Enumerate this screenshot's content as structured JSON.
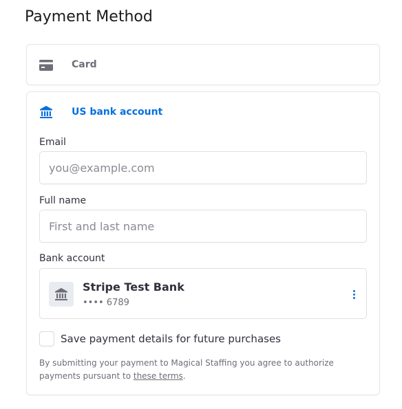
{
  "title": "Payment Method",
  "methods": {
    "card": {
      "label": "Card",
      "icon": "credit-card-icon"
    },
    "bank": {
      "label": "US bank account",
      "icon": "bank-icon"
    }
  },
  "form": {
    "email": {
      "label": "Email",
      "placeholder": "you@example.com",
      "value": ""
    },
    "name": {
      "label": "Full name",
      "placeholder": "First and last name",
      "value": ""
    },
    "bank_account": {
      "label": "Bank account",
      "bank_name": "Stripe Test Bank",
      "last4": "•••• 6789",
      "icon": "bank-icon"
    },
    "save": {
      "label": "Save payment details for future purchases",
      "checked": false
    }
  },
  "terms": {
    "text": "By submitting your payment to Magical Staffing you agree to authorize payments pursuant to ",
    "link": "these terms",
    "end": "."
  },
  "colors": {
    "accent": "#0570de",
    "muted": "#6d6e78",
    "text": "#30313d",
    "border": "#e3e6ea"
  }
}
